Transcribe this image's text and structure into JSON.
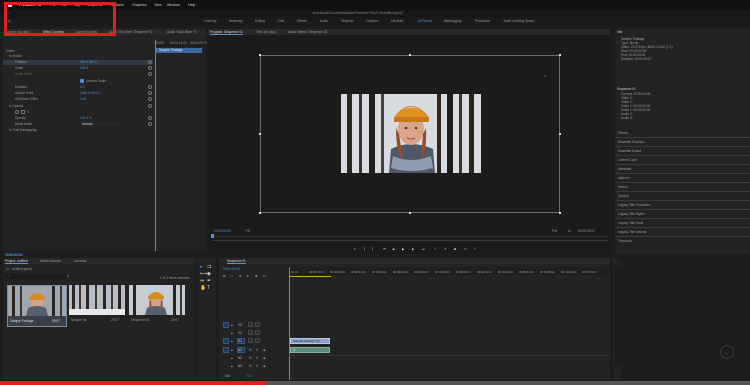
{
  "menubar": {
    "app_name": "Premiere Pro",
    "items": [
      "File",
      "Edit",
      "Clip",
      "Sequence",
      "Markers",
      "Graphics",
      "View",
      "Window",
      "Help"
    ],
    "path": "/Users/ruhi/Documents/Adobe/Premiere Pro/27.0/Untitled.prproj *"
  },
  "workspaces": [
    "Learning",
    "Assembly",
    "Editing",
    "Color",
    "Effects",
    "Audio",
    "Graphics",
    "Captions",
    "Libraries",
    "All Panels",
    "Metalogging",
    "Production",
    "Justin's Editing Space"
  ],
  "active_workspace_index": 9,
  "source_panel": {
    "tabs": [
      "Source: (no clips)",
      "Effect Controls",
      "Lumetri Scopes",
      "Audio Clip Mixer: Sequence 01",
      "Audio Track Mixer: S"
    ],
    "active_tab_index": 1,
    "master_label": "Video",
    "ruler": [
      "00:00",
      "00:00:14:23",
      "00:00:29:23"
    ],
    "clip_label": "Sample Footage",
    "rows": [
      {
        "label": "fx Motion",
        "value": ""
      },
      {
        "label": "Position",
        "value": "960.0    540.0"
      },
      {
        "label": "Scale",
        "value": "100.0"
      },
      {
        "label": "Scale Width",
        "value": ""
      },
      {
        "label": "",
        "value": "Uniform Scale"
      },
      {
        "label": "Rotation",
        "value": "0.0"
      },
      {
        "label": "Anchor Point",
        "value": "1080.0   1920.0"
      },
      {
        "label": "Anti-flicker Filter",
        "value": "0.00"
      },
      {
        "label": "fx Opacity",
        "value": ""
      },
      {
        "label": "",
        "value": ""
      },
      {
        "label": "Opacity",
        "value": "100.0 %"
      },
      {
        "label": "Blend Mode",
        "value": "Normal"
      },
      {
        "label": "fx Time Remapping",
        "value": ""
      }
    ],
    "timecode": "00:00:00:00"
  },
  "program_monitor": {
    "tabs": [
      "Program: Sequence 01",
      "Text: (no clips)",
      "Audio Meters: Sequence 01"
    ],
    "active_tab_index": 0,
    "timecode_left": "00:00:00:00",
    "zoom": "Fit",
    "quality": "Full",
    "timecode_right": "00:00:29:07"
  },
  "info_panel": {
    "title": "Info",
    "clip_block": [
      "Sample Footage",
      "Type: Movie",
      "Video: 23.976 fps, 3840 x 2160 (1.0)",
      "",
      "Start: 00:00:00:00",
      "End: 00:00:29:06",
      "Duration: 00:00:29:07"
    ],
    "sequence_block_title": "Sequence 01",
    "sequence_block": [
      "Current: 00:00:00:00",
      "",
      "Video 3:",
      "Video 2:",
      "Video 1: 00:00:00:00",
      "Audio 1: 00:00:00:00",
      "Audio 2:",
      "Audio 3:"
    ],
    "panels": [
      "Effects",
      "Essential Graphics",
      "Essential Sound",
      "Lumetri Color",
      "Metadata",
      "Markers",
      "History",
      "Speech",
      "Legacy Title Properties",
      "Legacy Title Styles",
      "Legacy Title Tools",
      "Legacy Title Actions",
      "Timecode"
    ]
  },
  "project_panel": {
    "tabs": [
      "Project: Untitled",
      "Media Browser",
      "Libraries"
    ],
    "active_tab_index": 0,
    "project_name": "Untitled.prproj",
    "item_count": "1 of 3 items selected",
    "search_placeholder": "",
    "items": [
      {
        "name": "Sample Footage",
        "duration": "29:07",
        "selected": true
      },
      {
        "name": "Sample 08",
        "duration": "29:07",
        "selected": false
      },
      {
        "name": "Sequence 01",
        "duration": "29:07",
        "selected": false
      }
    ]
  },
  "timeline": {
    "tab": "Sequence 01",
    "timecode": "00:00:00:00",
    "ruler": [
      "00:00",
      "00:00:04:23",
      "00:00:09:23",
      "00:00:14:23",
      "00:00:19:23",
      "00:00:24:23",
      "00:00:29:23",
      "00:00:34:23",
      "00:00:39:23",
      "00:00:44:22",
      "00:00:49:22",
      "00:00:54:22",
      "00:00:59:22",
      "00:01:04:22",
      "00:01:09:22",
      "00:01:14:22"
    ],
    "video_tracks": [
      "V3",
      "V2",
      "V1"
    ],
    "audio_tracks": [
      "A1",
      "A2",
      "A3"
    ],
    "video_clip": "Sample Footage [V]",
    "audio_clip": "fx",
    "mix_label": "Mix",
    "mix_value": "0.0"
  },
  "colors": {
    "accent": "#4b8fe0",
    "highlight_box": "#e0201f",
    "progress_red": "#e0201f"
  },
  "progress": {
    "fraction": 0.355
  }
}
